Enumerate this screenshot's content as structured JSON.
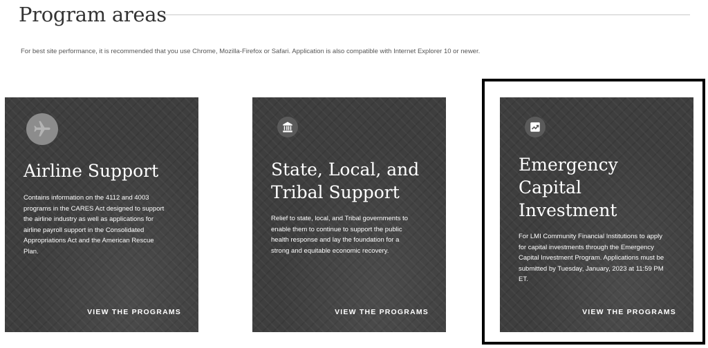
{
  "page": {
    "title": "Program areas",
    "notice": "For best site performance, it is recommended that you use Chrome, Mozilla-Firefox or Safari. Application is also compatible with Internet Explorer 10 or newer."
  },
  "cards": [
    {
      "icon": "airplane-icon",
      "title_lines": [
        "Airline Support"
      ],
      "description_lines": [
        "Contains information on the 4112 and 4003",
        "programs in the CARES Act designed to support",
        "the airline industry as well as applications for",
        "airline payroll support in the Consolidated",
        "Appropriations Act and the American Rescue",
        "Plan."
      ],
      "link": "VIEW THE PROGRAMS"
    },
    {
      "icon": "government-building-icon",
      "title_lines": [
        "State, Local, and",
        "Tribal Support"
      ],
      "description_lines": [
        "Relief to state, local, and Tribal governments to",
        "enable them to continue to support the public",
        "health response and lay the foundation for a",
        "strong and equitable economic recovery."
      ],
      "link": "VIEW THE PROGRAMS"
    },
    {
      "icon": "trending-up-icon",
      "title_lines": [
        "Emergency",
        "Capital",
        "Investment"
      ],
      "description_lines": [
        "For LMI Community Financial Institutions to apply",
        "for capital investments through the Emergency",
        "Capital Investment Program. Applications must be",
        "submitted by Tuesday, January, 2023 at 11:59 PM",
        "ET."
      ],
      "link": "VIEW THE PROGRAMS"
    }
  ]
}
